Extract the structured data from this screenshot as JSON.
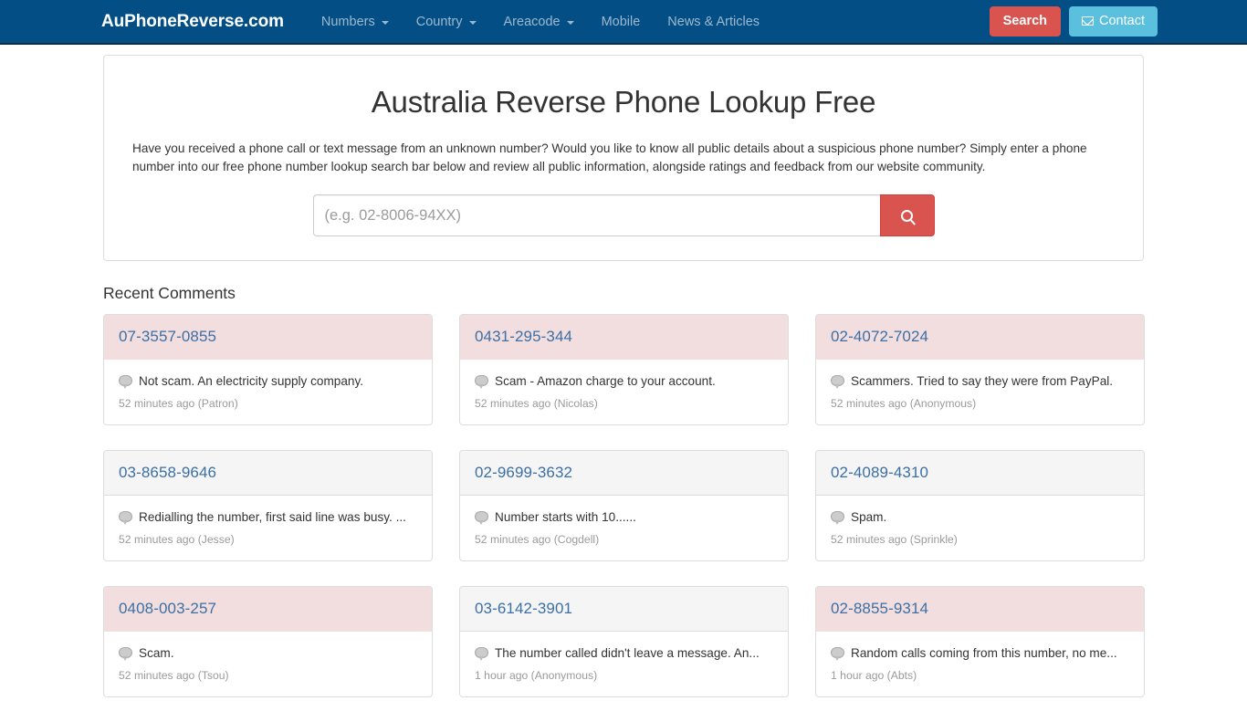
{
  "navbar": {
    "brand": "AuPhoneReverse.com",
    "links": [
      {
        "label": "Numbers",
        "caret": true,
        "name": "nav-numbers"
      },
      {
        "label": "Country",
        "caret": true,
        "name": "nav-country"
      },
      {
        "label": "Areacode",
        "caret": true,
        "name": "nav-areacode"
      },
      {
        "label": "Mobile",
        "caret": false,
        "name": "nav-mobile"
      },
      {
        "label": "News & Articles",
        "caret": false,
        "name": "nav-news-articles"
      }
    ],
    "search_button": "Search",
    "contact_button": "Contact",
    "contact_icon": "envelope-icon",
    "background_color": "#034f85",
    "search_button_color": "#d9534f",
    "contact_button_color": "#5bc0de"
  },
  "hero": {
    "title": "Australia Reverse Phone Lookup Free",
    "description": "Have you received a phone call or text message from an unknown number? Would you like to know all public details about a suspicious phone number? Simply enter a phone number into our free phone number lookup search bar below and review all public information, alongside ratings and feedback from our website community.",
    "search_placeholder": "(e.g. 02-8006-94XX)",
    "search_value": "",
    "search_icon": "magnifier-icon"
  },
  "recent_comments": {
    "section_title": "Recent Comments",
    "cards": [
      {
        "number": "07-3557-0855",
        "comment": "Not scam. An electricity supply company.",
        "meta": "52 minutes ago (Patron)",
        "style": "danger"
      },
      {
        "number": "0431-295-344",
        "comment": "Scam - Amazon charge to your account.",
        "meta": "52 minutes ago (Nicolas)",
        "style": "danger"
      },
      {
        "number": "02-4072-7024",
        "comment": "Scammers. Tried to say they were from PayPal.",
        "meta": "52 minutes ago (Anonymous)",
        "style": "danger"
      },
      {
        "number": "03-8658-9646",
        "comment": "Redialling the number, first said line was busy. ...",
        "meta": "52 minutes ago (Jesse)",
        "style": "default"
      },
      {
        "number": "02-9699-3632",
        "comment": "Number starts with 10......",
        "meta": "52 minutes ago (Cogdell)",
        "style": "default"
      },
      {
        "number": "02-4089-4310",
        "comment": "Spam.",
        "meta": "52 minutes ago (Sprinkle)",
        "style": "default"
      },
      {
        "number": "0408-003-257",
        "comment": "Scam.",
        "meta": "52 minutes ago (Tsou)",
        "style": "danger"
      },
      {
        "number": "03-6142-3901",
        "comment": "The number called didn't leave a message. An...",
        "meta": "1 hour ago (Anonymous)",
        "style": "default"
      },
      {
        "number": "02-8855-9314",
        "comment": "Random calls coming from this number, no me...",
        "meta": "1 hour ago (Abts)",
        "style": "danger"
      }
    ],
    "comment_icon": "comment-bubble-icon",
    "danger_header_color": "#f2dede",
    "default_header_color": "#f5f5f5",
    "number_link_color": "#3c6fa5"
  }
}
